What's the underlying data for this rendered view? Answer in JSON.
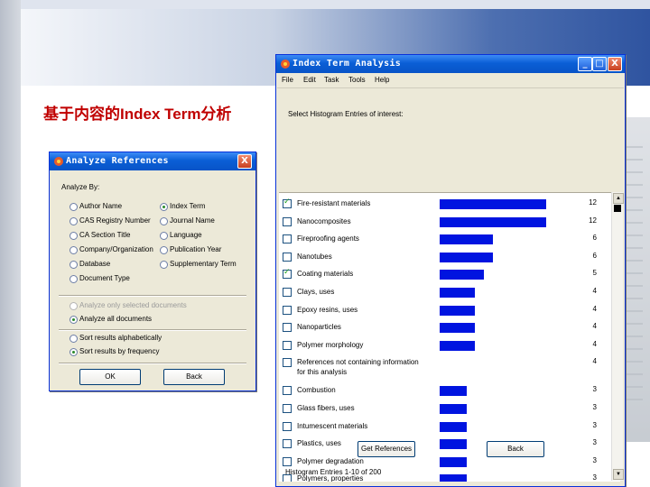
{
  "slide": {
    "title": "基于内容的Index Term分析"
  },
  "analyze": {
    "title": "Analyze References",
    "close": "X",
    "heading": "Analyze By:",
    "options": [
      {
        "label": "Author Name",
        "selected": false
      },
      {
        "label": "Index Term",
        "selected": true
      },
      {
        "label": "CAS Registry Number",
        "selected": false
      },
      {
        "label": "Journal Name",
        "selected": false
      },
      {
        "label": "CA Section Title",
        "selected": false
      },
      {
        "label": "Language",
        "selected": false
      },
      {
        "label": "Company/Organization",
        "selected": false
      },
      {
        "label": "Publication Year",
        "selected": false
      },
      {
        "label": "Database",
        "selected": false
      },
      {
        "label": "Supplementary Term",
        "selected": false
      },
      {
        "label": "Document Type",
        "selected": false
      }
    ],
    "scope": [
      {
        "label": "Analyze only selected documents",
        "selected": false,
        "disabled": true
      },
      {
        "label": "Analyze all documents",
        "selected": true,
        "disabled": false
      }
    ],
    "sort": [
      {
        "label": "Sort results alphabetically",
        "selected": false
      },
      {
        "label": "Sort results by frequency",
        "selected": true
      }
    ],
    "ok": "OK",
    "back": "Back"
  },
  "index": {
    "title": "Index Term Analysis",
    "buttons": {
      "min": "_",
      "max": "□",
      "close": "X"
    },
    "menu": [
      "File",
      "Edit",
      "Task",
      "Tools",
      "Help"
    ],
    "prompt": "Select Histogram Entries of interest:",
    "entries": [
      {
        "label": "Fire-resistant materials",
        "count": 12,
        "checked": true
      },
      {
        "label": "Nanocomposites",
        "count": 12,
        "checked": false
      },
      {
        "label": "Fireproofing agents",
        "count": 6,
        "checked": false
      },
      {
        "label": "Nanotubes",
        "count": 6,
        "checked": false
      },
      {
        "label": "Coating materials",
        "count": 5,
        "checked": true
      },
      {
        "label": "Clays, uses",
        "count": 4,
        "checked": false
      },
      {
        "label": "Epoxy resins, uses",
        "count": 4,
        "checked": false
      },
      {
        "label": "Nanoparticles",
        "count": 4,
        "checked": false
      },
      {
        "label": "Polymer morphology",
        "count": 4,
        "checked": false
      },
      {
        "label": "References not containing information for this analysis",
        "count": 4,
        "checked": false
      },
      {
        "label": "Combustion",
        "count": 3,
        "checked": false
      },
      {
        "label": "Glass fibers, uses",
        "count": 3,
        "checked": false
      },
      {
        "label": "Intumescent materials",
        "count": 3,
        "checked": false
      },
      {
        "label": "Plastics, uses",
        "count": 3,
        "checked": false
      },
      {
        "label": "Polymer degradation",
        "count": 3,
        "checked": false
      },
      {
        "label": "Polymers, properties",
        "count": 3,
        "checked": false
      }
    ],
    "max_count": 12,
    "get_refs": "Get References",
    "back": "Back",
    "status": "Histogram Entries 1-10 of 200"
  },
  "colors": {
    "bar": "#0014e0",
    "titlebar": "#0a5fd6",
    "slide_title": "#c00000"
  }
}
